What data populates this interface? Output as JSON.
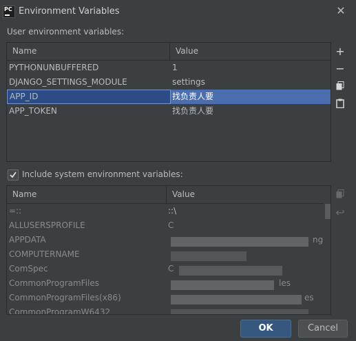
{
  "window": {
    "title": "Environment Variables"
  },
  "user_section": {
    "label": "User environment variables:"
  },
  "user_table": {
    "headers": [
      "Name",
      "Value"
    ],
    "rows": [
      {
        "name": "PYTHONUNBUFFERED",
        "value": "1"
      },
      {
        "name": "DJANGO_SETTINGS_MODULE",
        "value": "settings"
      },
      {
        "name": "APP_ID",
        "value": "找负责人要",
        "selected": true
      },
      {
        "name": "APP_TOKEN",
        "value": "找负责人要"
      }
    ]
  },
  "side_toolbar": {
    "add_icon": "plus-icon",
    "remove_icon": "minus-icon",
    "copy_icon": "copy-icon",
    "paste_icon": "paste-icon"
  },
  "system_section": {
    "checkbox_label": "Include system environment variables:",
    "checked": true
  },
  "system_table": {
    "headers": [
      "Name",
      "Value"
    ],
    "rows": [
      {
        "name": "=::",
        "value": "::\\"
      },
      {
        "name": "ALLUSERSPROFILE",
        "value": "C"
      },
      {
        "name": "APPDATA",
        "value": "ng"
      },
      {
        "name": "COMPUTERNAME",
        "value": ""
      },
      {
        "name": "ComSpec",
        "value": "C"
      },
      {
        "name": "CommonProgramFiles",
        "value": "les"
      },
      {
        "name": "CommonProgramFiles(x86)",
        "value": "es"
      },
      {
        "name": "CommonProgramW6432",
        "value": ""
      }
    ]
  },
  "buttons": {
    "ok": "OK",
    "cancel": "Cancel"
  },
  "colors": {
    "background": "#3c3f41",
    "selection": "#4b6eaf",
    "ok_button": "#365880"
  }
}
